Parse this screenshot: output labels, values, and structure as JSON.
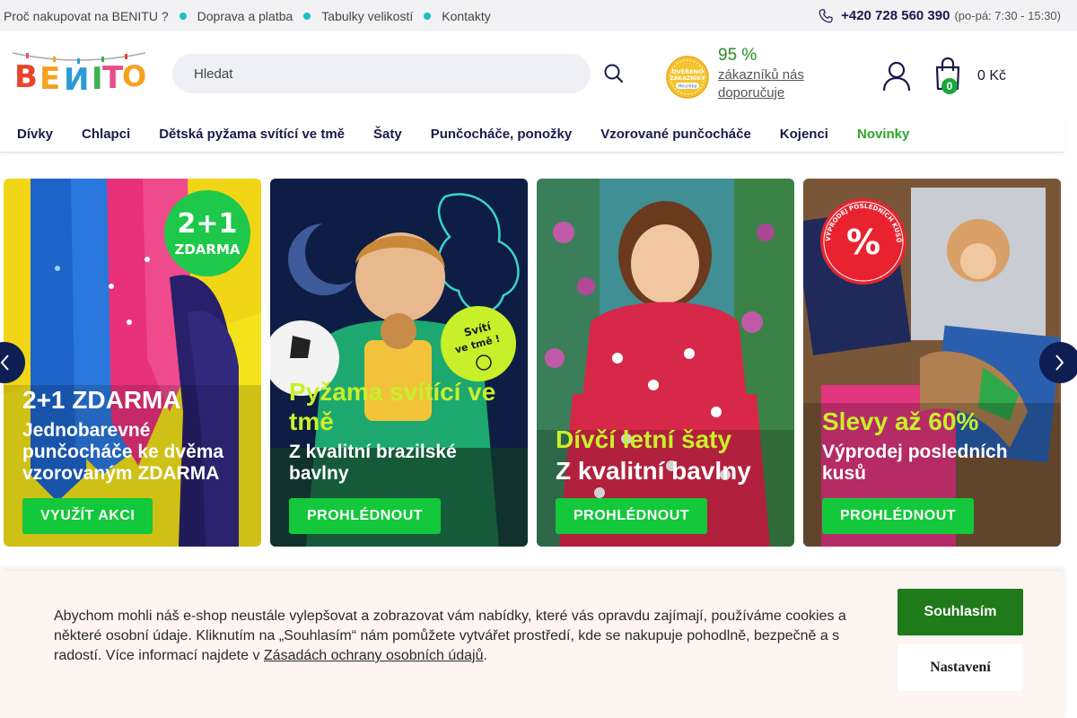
{
  "topbar": {
    "links": [
      "Proč nakupovat na BENITU ?",
      "Doprava a platba",
      "Tabulky velikostí",
      "Kontakty"
    ],
    "phone": "+420 728 560 390",
    "hours": "(po-pá: 7:30 - 15:30)"
  },
  "header": {
    "logo_text": "BENITO",
    "search_placeholder": "Hledat",
    "badge_lines": [
      "OVĚŘENO",
      "ZÁKAZNÍKY",
      "Heureka"
    ],
    "rating_percent": "95 %",
    "rating_text": "zákazníků nás doporučuje",
    "cart_count": "0",
    "cart_total": "0 Kč"
  },
  "nav": {
    "items": [
      "Dívky",
      "Chlapci",
      "Dětská pyžama svítící ve tmě",
      "Šaty",
      "Punčocháče, ponožky",
      "Vzorované punčocháče",
      "Kojenci",
      "Novinky"
    ]
  },
  "banners": [
    {
      "title": "2+1 ZDARMA",
      "subtitle": "Jednobarevné punčocháče ke dvěma vzorovaným ZDARMA",
      "button": "VYUŽÍT AKCI",
      "sticker": [
        "2+1",
        "ZDARMA"
      ],
      "title_color": "#ffffff"
    },
    {
      "title": "Pyžama svítící ve tmě",
      "subtitle": "Z kvalitní brazilské bavlny",
      "button": "PROHLÉDNOUT",
      "sticker": [
        "Svítí",
        "ve tmě !"
      ],
      "title_color": "#c8f02a"
    },
    {
      "title": "Dívčí letní šaty",
      "subtitle": "Z kvalitní bavlny",
      "button": "PROHLÉDNOUT",
      "title_color": "#c8f02a"
    },
    {
      "title": "Slevy až 60%",
      "subtitle": "Výprodej posledních kusů",
      "button": "PROHLÉDNOUT",
      "sticker": [
        "%",
        "VÝPRODEJ POSLEDNÍCH KUSŮ"
      ],
      "title_color": "#c8f02a"
    }
  ],
  "cookie": {
    "text": "Abychom mohli náš e-shop neustále vylepšovat a zobrazovat vám nabídky, které vás opravdu zajímají, používáme cookies a některé osobní údaje. Kliknutím na „Souhlasím“ nám pomůžete vytvářet prostředí, kde se nakupuje pohodlně, bezpečně a s radostí. Více informací najdete v ",
    "link": "Zásadách ochrany osobních údajů",
    "end": ".",
    "agree": "Souhlasím",
    "settings": "Nastavení"
  },
  "colors": {
    "accent_cyan": "#1bbdc9",
    "button_green": "#13c83a",
    "agree_green": "#1f7a1a",
    "navy": "#1a1a4a"
  }
}
